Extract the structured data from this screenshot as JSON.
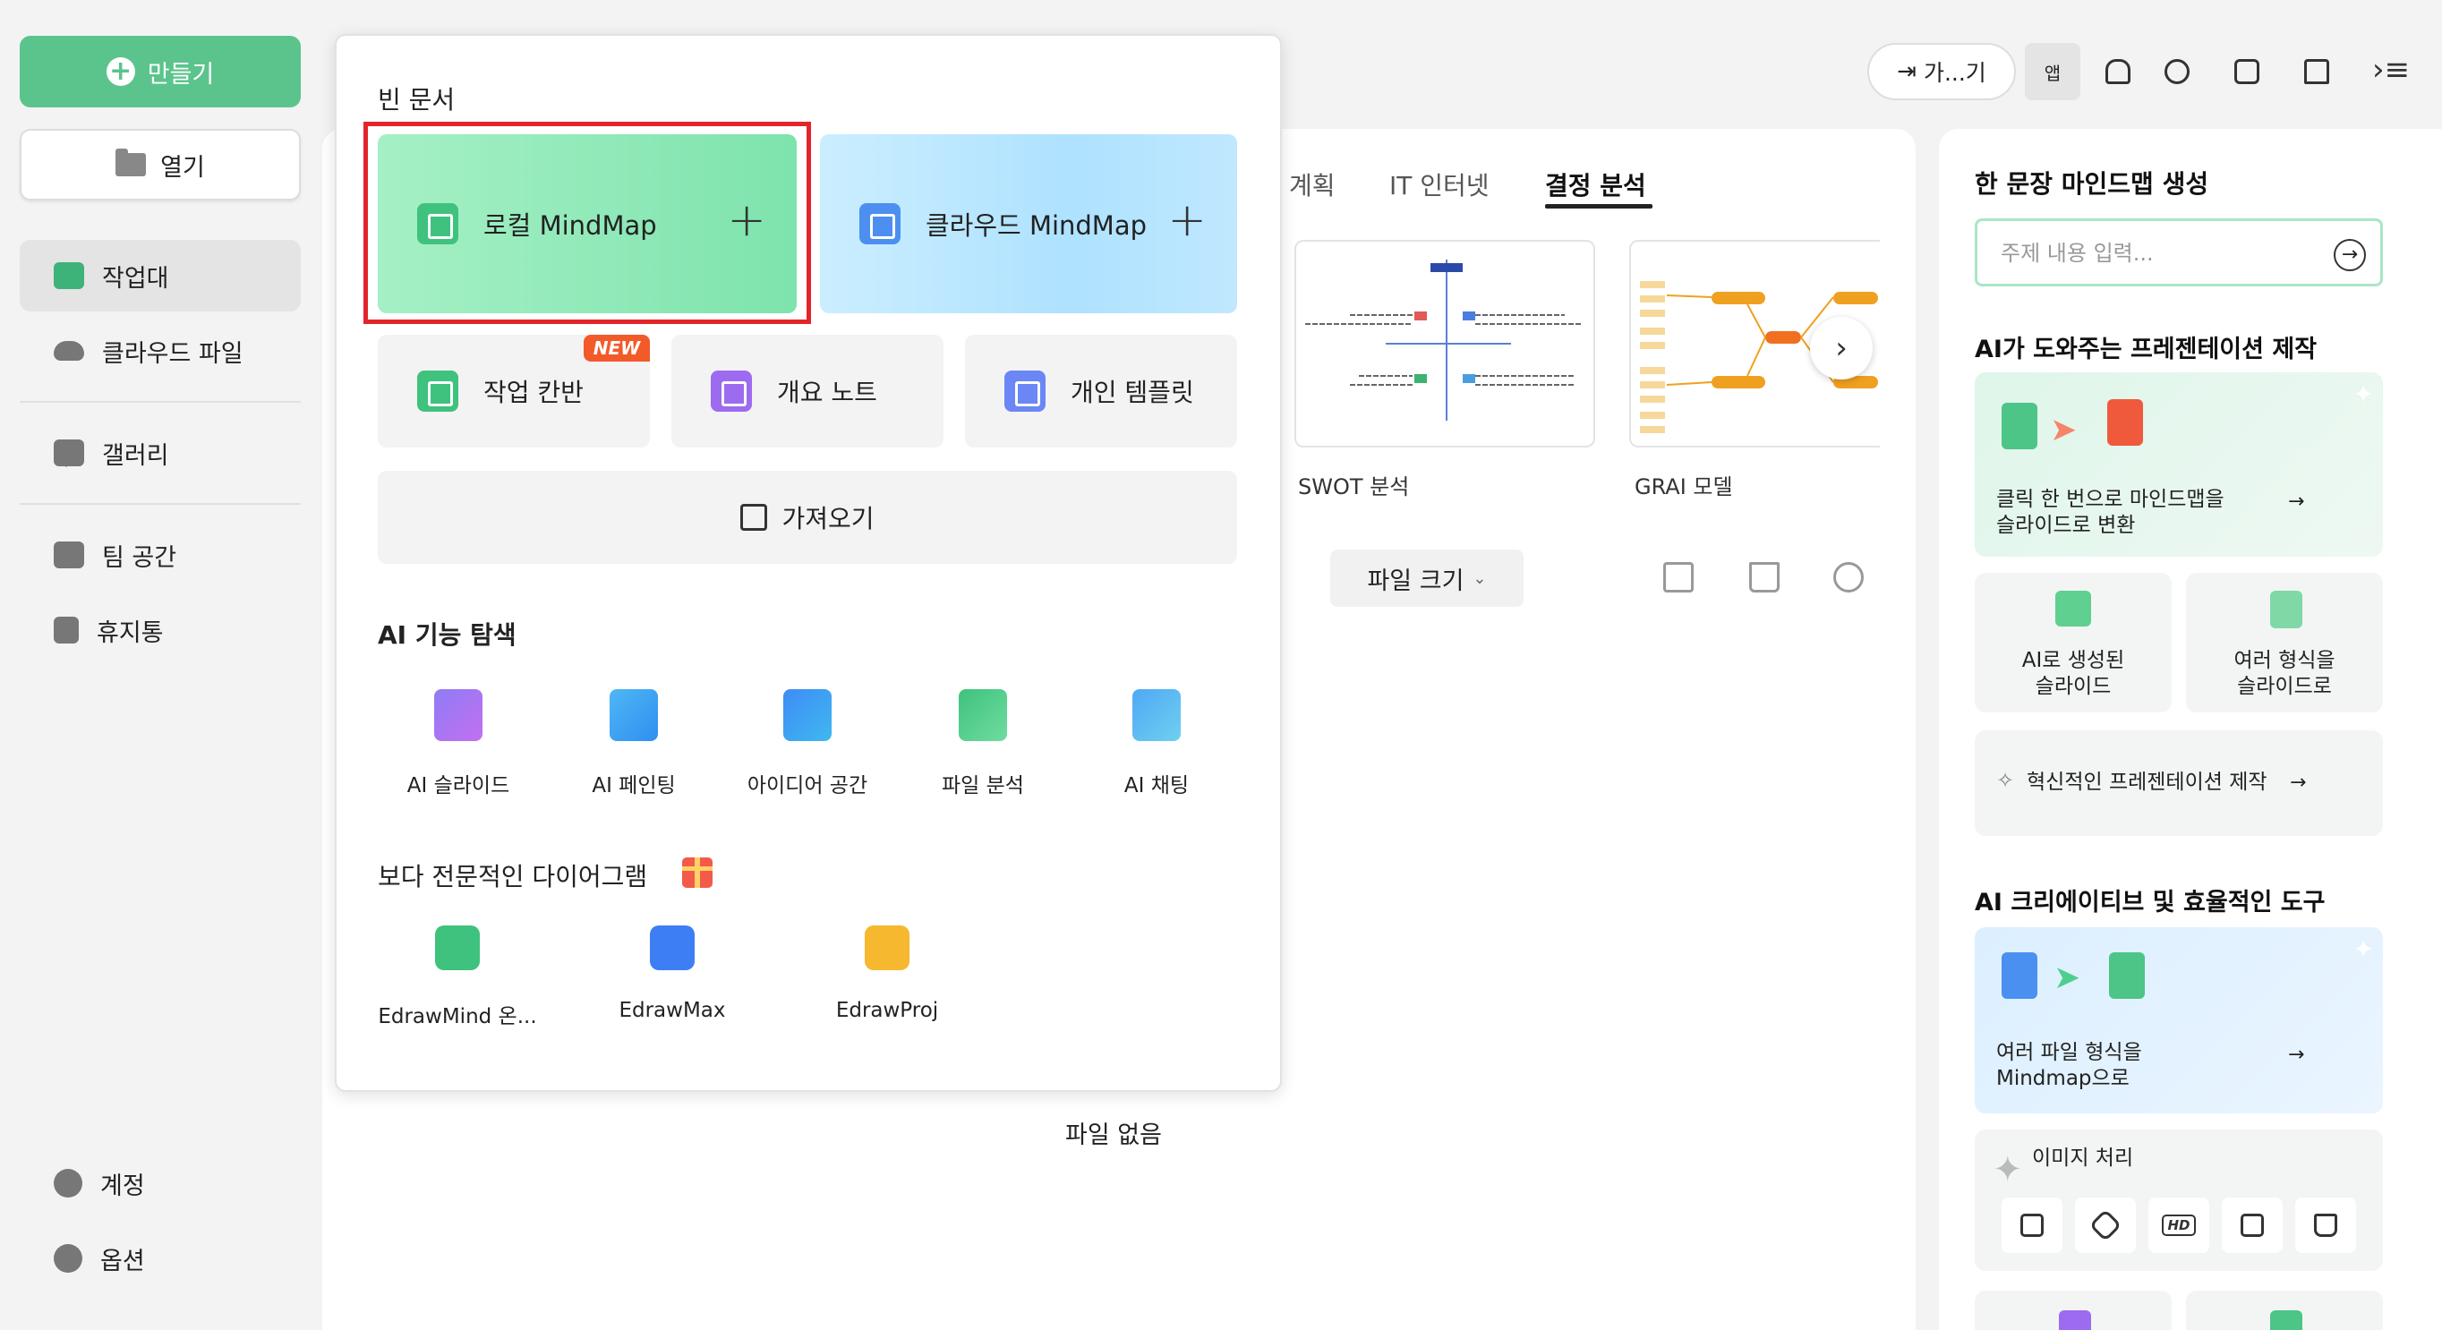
{
  "sidebar": {
    "create_label": "만들기",
    "open_label": "열기",
    "items": [
      {
        "label": "작업대"
      },
      {
        "label": "클라우드 파일"
      },
      {
        "label": "갤러리"
      },
      {
        "label": "팀 공간"
      },
      {
        "label": "휴지통"
      }
    ],
    "bottom": [
      {
        "label": "계정"
      },
      {
        "label": "옵션"
      }
    ]
  },
  "topbar": {
    "import_label": "가...기",
    "app_label": "앱"
  },
  "main": {
    "tabs": [
      {
        "label": "계획"
      },
      {
        "label": "IT 인터넷"
      },
      {
        "label": "결정 분석"
      }
    ],
    "templates": [
      {
        "name": "SWOT 분석"
      },
      {
        "name": "GRAI 모델"
      }
    ],
    "file_size_label": "파일 크기",
    "empty_text": "파일 없음"
  },
  "popup": {
    "blank_heading": "빈 문서",
    "local_mindmap": "로컬 MindMap",
    "cloud_mindmap": "클라우드 MindMap",
    "sub_cards": [
      {
        "label": "작업 칸반"
      },
      {
        "label": "개요 노트"
      },
      {
        "label": "개인 템플릿"
      }
    ],
    "new_badge": "NEW",
    "import_label": "가져오기",
    "ai_heading": "AI 기능 탐색",
    "ai_items": [
      {
        "label": "AI 슬라이드"
      },
      {
        "label": "AI 페인팅"
      },
      {
        "label": "아이디어 공간"
      },
      {
        "label": "파일 분석"
      },
      {
        "label": "AI 채팅"
      }
    ],
    "pro_heading": "보다 전문적인 다이어그램",
    "pro_items": [
      {
        "label": "EdrawMind 온..."
      },
      {
        "label": "EdrawMax"
      },
      {
        "label": "EdrawProj"
      }
    ]
  },
  "right_panel": {
    "mindmap_title": "한 문장 마인드맵 생성",
    "input_placeholder": "주제 내용 입력...",
    "pres_title": "AI가 도와주는 프레젠테이션 제작",
    "pres_card_line1": "클릭 한 번으로 마인드맵을",
    "pres_card_line2": "슬라이드로 변환",
    "ai_slide_line1": "AI로 생성된",
    "ai_slide_line2": "슬라이드",
    "multi_format_line1": "여러 형식을",
    "multi_format_line2": "슬라이드로",
    "innovative": "혁신적인 프레젠테이션 제작",
    "tools_title": "AI 크리에이티브 및 효율적인 도구",
    "files_card_line1": "여러 파일 형식을",
    "files_card_line2": "Mindmap으로",
    "image_title": "이미지 처리",
    "hd_label": "HD"
  },
  "colors": {
    "brand_green": "#5bc48d",
    "selection_red": "#e3252a",
    "new_badge": "#f25a2a"
  }
}
